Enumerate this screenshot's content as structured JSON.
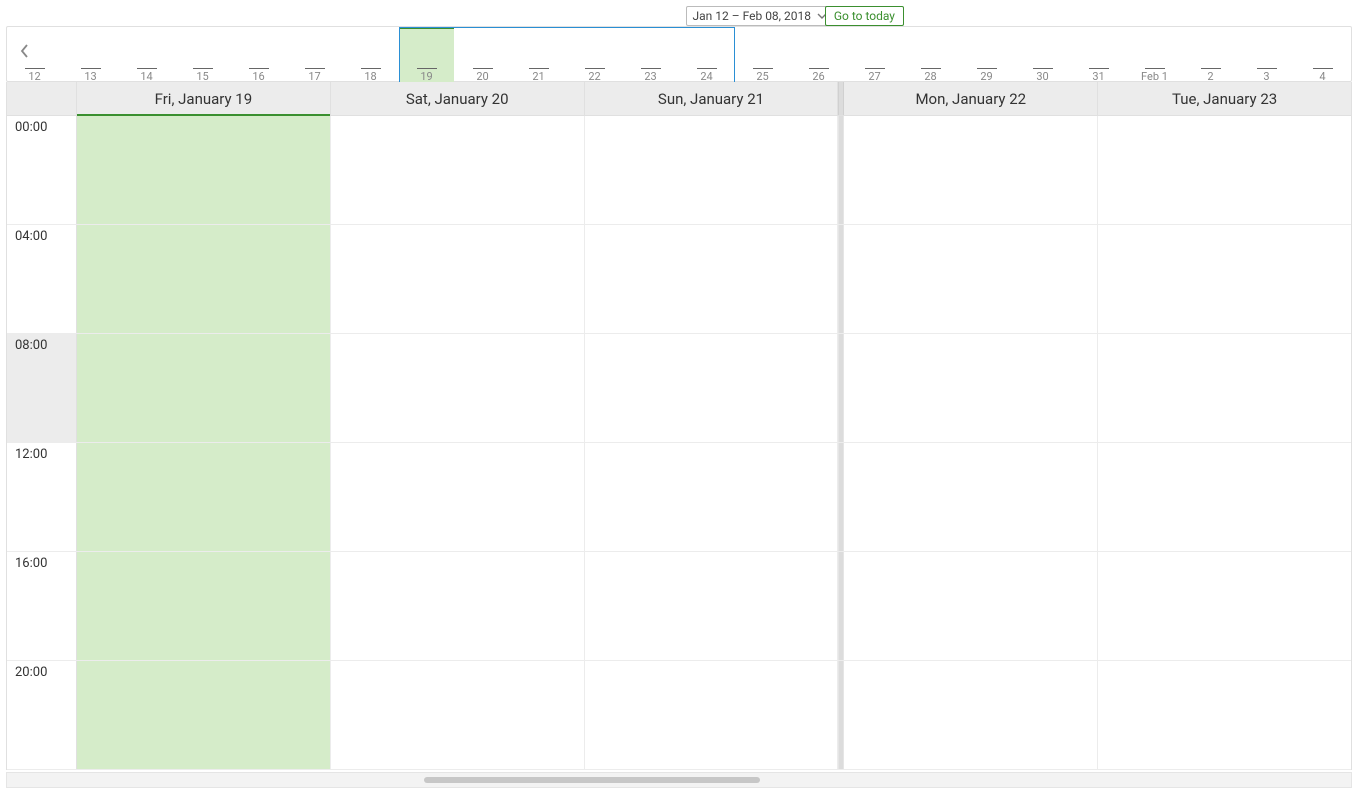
{
  "toolbar": {
    "range_label": "Jan 12 – Feb 08, 2018",
    "go_today_label": "Go to today"
  },
  "timeline": {
    "ticks": [
      {
        "label": "12"
      },
      {
        "label": "13"
      },
      {
        "label": "14"
      },
      {
        "label": "15"
      },
      {
        "label": "16"
      },
      {
        "label": "17"
      },
      {
        "label": "18"
      },
      {
        "label": "19",
        "today": true
      },
      {
        "label": "20"
      },
      {
        "label": "21"
      },
      {
        "label": "22"
      },
      {
        "label": "23"
      },
      {
        "label": "24"
      },
      {
        "label": "25"
      },
      {
        "label": "26"
      },
      {
        "label": "27"
      },
      {
        "label": "28"
      },
      {
        "label": "29"
      },
      {
        "label": "30"
      },
      {
        "label": "31"
      },
      {
        "label": "Feb 1"
      },
      {
        "label": "2"
      },
      {
        "label": "3"
      },
      {
        "label": "4"
      }
    ],
    "viewport_start_index": 7,
    "viewport_span_days": 6
  },
  "days": [
    {
      "label": "Fri, January 19",
      "today": true,
      "weekend": false
    },
    {
      "label": "Sat, January 20",
      "today": false,
      "weekend": true
    },
    {
      "label": "Sun, January 21",
      "today": false,
      "weekend": true
    },
    {
      "label": "Mon, January 22",
      "today": false,
      "weekend": false
    },
    {
      "label": "Tue, January 23",
      "today": false,
      "weekend": false
    }
  ],
  "time_rows": [
    {
      "label": "00:00",
      "current": false
    },
    {
      "label": "04:00",
      "current": false
    },
    {
      "label": "08:00",
      "current": true
    },
    {
      "label": "12:00",
      "current": false
    },
    {
      "label": "16:00",
      "current": false
    },
    {
      "label": "20:00",
      "current": false
    }
  ]
}
